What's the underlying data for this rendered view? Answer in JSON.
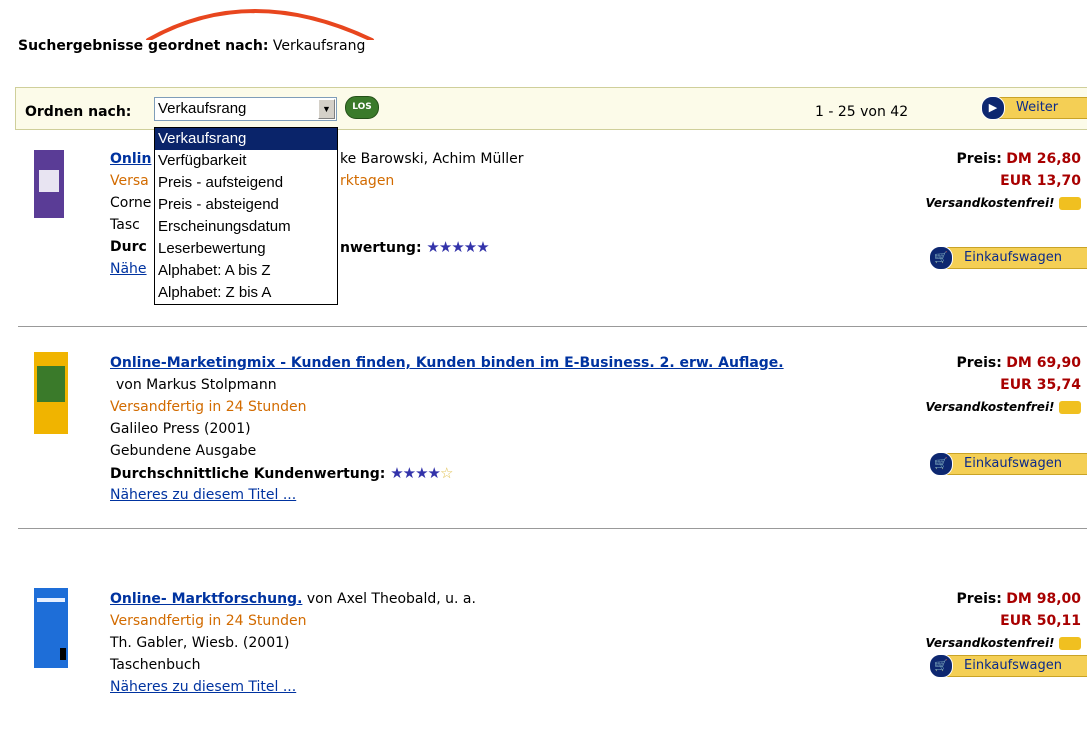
{
  "heading": {
    "label": "Suchergebnisse geordnet nach:",
    "value": "Verkaufsrang"
  },
  "sortbar": {
    "label": "Ordnen nach:",
    "selected": "Verkaufsrang",
    "go_button": "LOS",
    "count": "1 - 25 von 42",
    "next_button": "Weiter",
    "options": [
      "Verkaufsrang",
      "Verfügbarkeit",
      "Preis - aufsteigend",
      "Preis - absteigend",
      "Erscheinungsdatum",
      "Leserbewertung",
      "Alphabet: A bis Z",
      "Alphabet: Z bis A"
    ]
  },
  "results": [
    {
      "title_visible": "Onlin",
      "author_visible": "ke Barowski, Achim Müller",
      "shipping_visible": "Versa",
      "shipping_tail": "rktagen",
      "publisher_visible": "Corne",
      "format_visible": "Tasc",
      "rating_label_visible": "Durc",
      "rating_tail": "nwertung:",
      "rating": 5,
      "details_visible": "Nähe",
      "price_label": "Preis:",
      "price_dm": "DM 26,80",
      "price_eur": "EUR 13,70",
      "shipping_free": "Versandkostenfrei!",
      "cart_button": "Einkaufswagen"
    },
    {
      "title": "Online-Marketingmix - Kunden finden, Kunden binden im E-Business. 2. erw. Auflage.",
      "author": "von Markus Stolpmann",
      "shipping": "Versandfertig in 24 Stunden",
      "publisher": "Galileo Press (2001)",
      "format": "Gebundene Ausgabe",
      "rating_label": "Durchschnittliche Kundenwertung:",
      "rating": 4,
      "details": "Näheres zu diesem Titel ...",
      "price_label": "Preis:",
      "price_dm": "DM 69,90",
      "price_eur": "EUR 35,74",
      "shipping_free": "Versandkostenfrei!",
      "cart_button": "Einkaufswagen"
    },
    {
      "title": "Online- Marktforschung.",
      "author": "von Axel Theobald, u. a.",
      "shipping": "Versandfertig in 24 Stunden",
      "publisher": "Th. Gabler, Wiesb. (2001)",
      "format": "Taschenbuch",
      "details": "Näheres zu diesem Titel ...",
      "price_label": "Preis:",
      "price_dm": "DM 98,00",
      "price_eur": "EUR 50,11",
      "shipping_free": "Versandkostenfrei!",
      "cart_button": "Einkaufswagen"
    }
  ],
  "colors": {
    "link": "#0033a0",
    "shipping": "#d26b00",
    "price": "#a80000",
    "accent_arc": "#e8461e"
  }
}
